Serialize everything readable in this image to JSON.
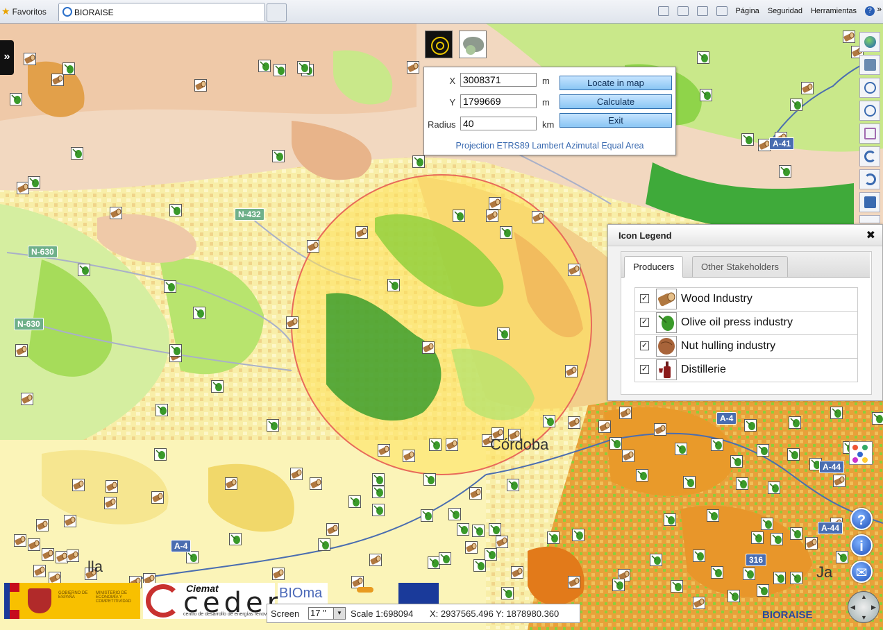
{
  "browser": {
    "favorites": "Favoritos",
    "tab_title": "BIORAISE",
    "tools": [
      "Página",
      "Seguridad",
      "Herramientas"
    ],
    "overflow": "»"
  },
  "map": {
    "road_labels": [
      "N-432",
      "N-630",
      "N-630",
      "A-41",
      "A-4",
      "A-44",
      "A-44",
      "A-4",
      "316"
    ],
    "cities": [
      "Córdoba",
      "lla",
      "Ja"
    ]
  },
  "coord_panel": {
    "x_label": "X",
    "x_value": "3008371",
    "y_label": "Y",
    "y_value": "1799669",
    "radius_label": "Radius",
    "radius_value": "40",
    "unit_m": "m",
    "unit_km": "km",
    "locate_button": "Locate in map",
    "calculate_button": "Calculate",
    "exit_button": "Exit",
    "projection": "Projection ETRS89 Lambert Azimutal Equal Area"
  },
  "legend": {
    "title": "Icon Legend",
    "close": "✖",
    "tabs": [
      "Producers",
      "Other Stakeholders"
    ],
    "items": [
      {
        "label": "Wood Industry",
        "icon": "wood-log-icon",
        "checked": true
      },
      {
        "label": "Olive oil press industry",
        "icon": "olive-icon",
        "checked": true
      },
      {
        "label": "Nut hulling industry",
        "icon": "nut-icon",
        "checked": true
      },
      {
        "label": "Distillerie",
        "icon": "wine-bottle-icon",
        "checked": true
      }
    ]
  },
  "status": {
    "screen_label": "Screen",
    "screen_value": "17 \"",
    "scale": "Scale 1:698094",
    "coords": "X: 2937565.496 Y: 1878980.360"
  },
  "logos": {
    "ciemat": "Ciemat",
    "ceder": "ceder",
    "ceder_sub": "centro de desarrollo de energías renovab",
    "bioma": "BIOma",
    "gob1": "GOBIERNO DE ESPAÑA",
    "gob2": "MINISTERIO DE ECONOMÍA Y COMPETITIVIDAD",
    "bioraise": "BIORAISE"
  },
  "colors": {
    "circle": "#ffe15a",
    "button": "#8ac6f4",
    "olive": "#2f8a2a",
    "wood": "#8a5a2a"
  }
}
